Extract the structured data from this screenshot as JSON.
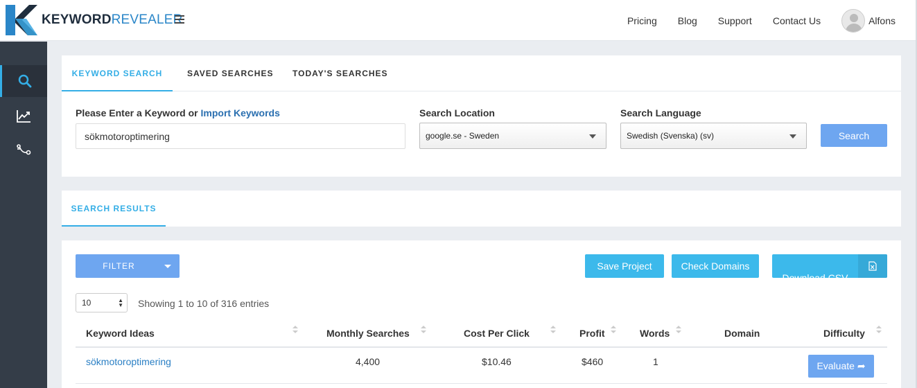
{
  "brand": {
    "bold": "KEYWORD",
    "light": "REVEALER"
  },
  "nav": {
    "links": [
      "Pricing",
      "Blog",
      "Support",
      "Contact Us"
    ],
    "user_name": "Alfons"
  },
  "sidebar": {
    "items": [
      {
        "icon": "search-icon",
        "active": true
      },
      {
        "icon": "trend-chart-icon",
        "active": false
      },
      {
        "icon": "route-icon",
        "active": false
      }
    ]
  },
  "search_panel": {
    "tabs": [
      "KEYWORD SEARCH",
      "SAVED SEARCHES",
      "TODAY'S SEARCHES"
    ],
    "keyword_label": "Please Enter a Keyword or",
    "import_link": "Import Keywords",
    "keyword_value": "sökmotoroptimering",
    "location_label": "Search Location",
    "location_value": "google.se - Sweden",
    "language_label": "Search Language",
    "language_value": "Swedish (Svenska) (sv)",
    "search_button": "Search"
  },
  "results_panel": {
    "tab": "SEARCH RESULTS"
  },
  "table_panel": {
    "filter_label": "FILTER",
    "save_project": "Save Project",
    "check_domains": "Check Domains",
    "download_csv": "Download CSV",
    "page_length": "10",
    "showing_text": "Showing 1 to 10 of 316 entries",
    "columns": [
      "Keyword Ideas",
      "Monthly Searches",
      "Cost Per Click",
      "Profit",
      "Words",
      "Domain",
      "Difficulty"
    ],
    "rows": [
      {
        "keyword": "sökmotoroptimering",
        "monthly_searches": "4,400",
        "cpc": "$10.46",
        "profit": "$460",
        "words": "1",
        "domain": "",
        "difficulty_button": "Evaluate"
      }
    ]
  },
  "colors": {
    "accent": "#34aee6",
    "button_blue": "#6ea6f0",
    "sidebar": "#343d48"
  }
}
